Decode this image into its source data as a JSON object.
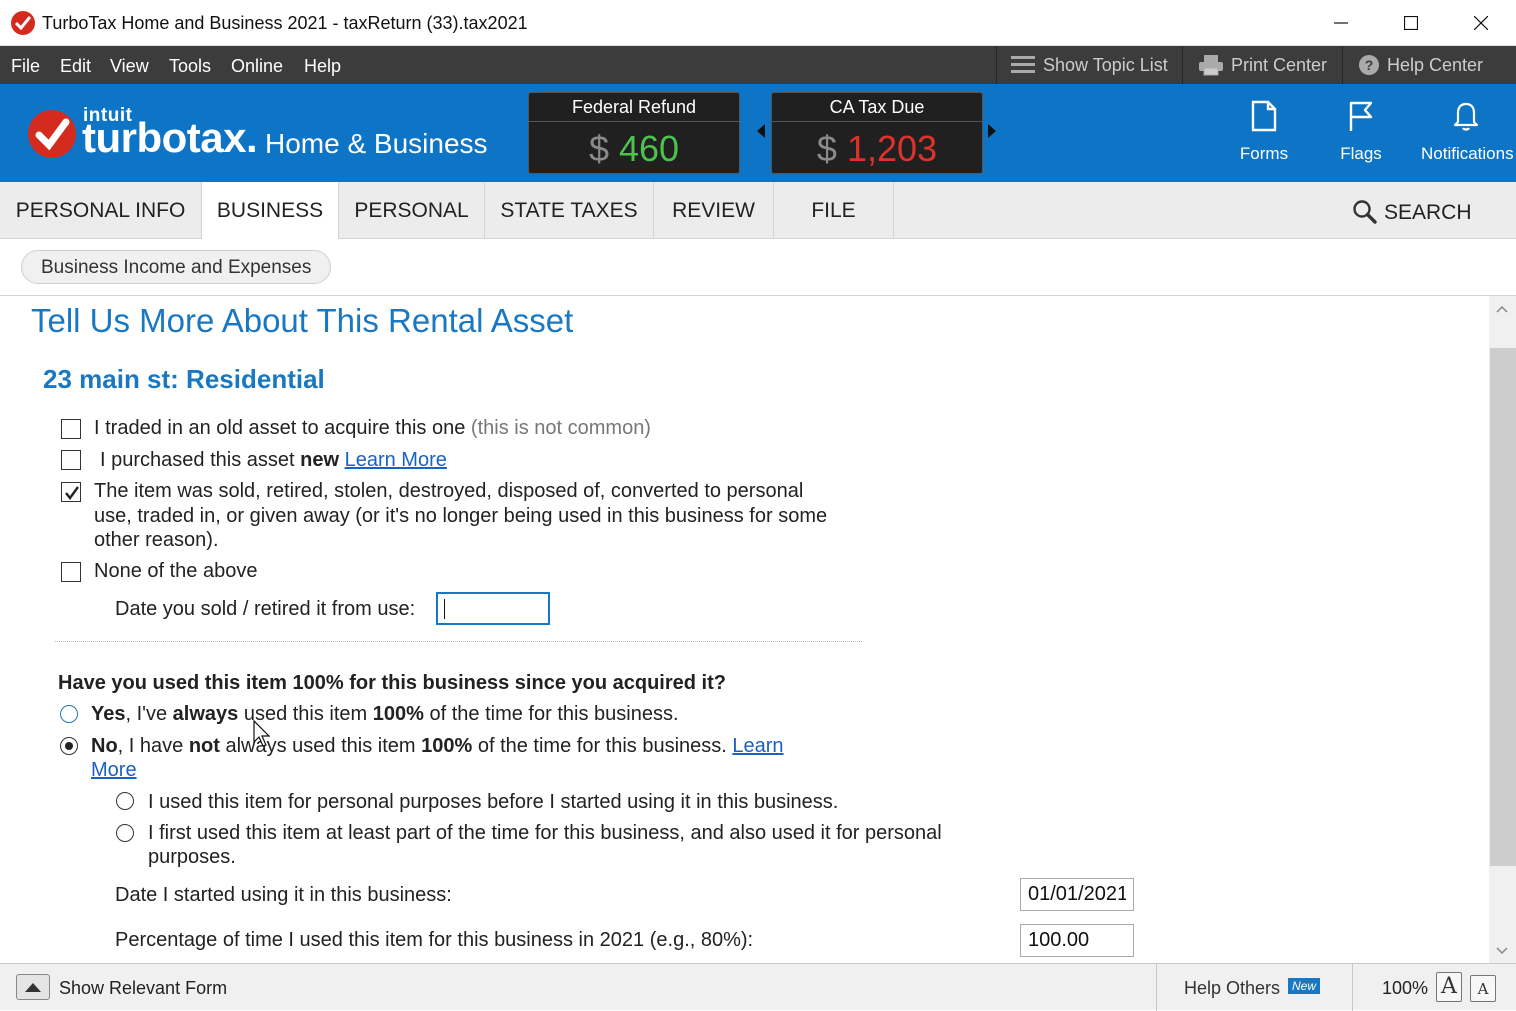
{
  "window": {
    "title": "TurboTax Home and Business 2021 - taxReturn (33).tax2021",
    "controls": [
      "minimize-icon",
      "maximize-icon",
      "close-icon"
    ]
  },
  "menu": {
    "items": [
      "File",
      "Edit",
      "View",
      "Tools",
      "Online",
      "Help"
    ],
    "show_topic_list": "Show Topic List",
    "print_center": "Print Center",
    "help_center": "Help Center"
  },
  "banner": {
    "logo_intuit": "intuit",
    "logo_turbotax": "turbotax.",
    "logo_edition": "Home & Business",
    "federal": {
      "label": "Federal Refund",
      "currency": "$",
      "amount": "460",
      "color": "#4cc24c"
    },
    "state": {
      "label": "CA Tax Due",
      "currency": "$",
      "amount": "1,203",
      "color": "#e0312a"
    },
    "buttons": {
      "forms": "Forms",
      "flags": "Flags",
      "notifications": "Notifications"
    }
  },
  "tabs": {
    "items": [
      "PERSONAL INFO",
      "BUSINESS",
      "PERSONAL",
      "STATE TAXES",
      "REVIEW",
      "FILE"
    ],
    "active": "BUSINESS",
    "search": "SEARCH"
  },
  "breadcrumb": {
    "label": "Business Income and Expenses"
  },
  "page": {
    "title": "Tell Us More About This Rental Asset",
    "subtitle": "23 main st: Residential",
    "checkboxes": {
      "traded": {
        "text": "I traded in an old asset to acquire this one",
        "note": "(this is not common)",
        "checked": false
      },
      "purchased": {
        "text_a": "I purchased this asset",
        "text_bold": "new",
        "link": "Learn More",
        "checked": false
      },
      "sold": {
        "line1": "The item was sold, retired, stolen, destroyed, disposed of, converted to personal",
        "line2": "use, traded in, or given away (or it's no longer being used in this business for some",
        "line3": "other reason).",
        "checked": true
      },
      "none": {
        "text": "None of the above",
        "checked": false
      }
    },
    "date_sold": {
      "label": "Date you sold / retired it from use:",
      "value": ""
    },
    "question": "Have you used this item 100% for this business since you acquired it?",
    "options": {
      "yes": {
        "b1": "Yes",
        "t1": ", I've ",
        "b2": "always",
        "t2": " used this item ",
        "b3": "100%",
        "t3": " of the time for this business.",
        "selected": false
      },
      "no": {
        "b1": "No",
        "t1": ", I have ",
        "b2": "not",
        "t2": " always used this item ",
        "b3": "100%",
        "t3": " of the time for this business. ",
        "link1": "Learn",
        "link2": "More",
        "selected": true
      }
    },
    "sub_options": {
      "personal_before": "I used this item for personal purposes before I started using it in this business.",
      "part_time_line1": "I first used this item at least part of the time for this business, and also used it for personal",
      "part_time_line2": "purposes."
    },
    "date_started": {
      "label": "Date I started using it in this business:",
      "value": "01/01/2021"
    },
    "percentage": {
      "label": "Percentage of time I used this item for this business in 2021 (e.g., 80%):",
      "value": "100.00"
    }
  },
  "statusbar": {
    "show_form": "Show Relevant Form",
    "help_others": "Help Others",
    "new_badge": "New",
    "zoom": "100%",
    "font_large": "A",
    "font_small": "A"
  }
}
